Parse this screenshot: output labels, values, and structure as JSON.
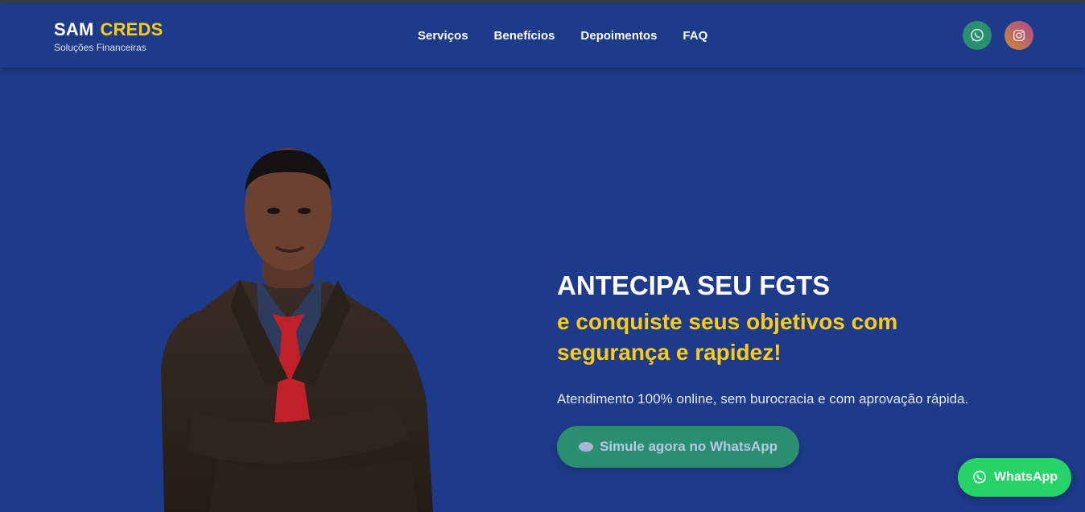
{
  "brand": {
    "name_primary": "SAM",
    "name_accent": "CREDS",
    "tagline": "Soluções Financeiras"
  },
  "nav": {
    "items": [
      {
        "label": "Serviços"
      },
      {
        "label": "Benefícios"
      },
      {
        "label": "Depoimentos"
      },
      {
        "label": "FAQ"
      }
    ]
  },
  "social": {
    "whatsapp_icon": "whatsapp-icon",
    "instagram_icon": "instagram-icon"
  },
  "hero": {
    "title": "ANTECIPA SEU FGTS",
    "subtitle": "e conquiste seus objetivos com segurança e rapidez!",
    "description": "Atendimento 100% online, sem burocracia e com aprovação rápida.",
    "cta_label": "Simule agora no WhatsApp",
    "photo": "man-in-suit-photo"
  },
  "floating_button": {
    "label": "WhatsApp"
  },
  "colors": {
    "background": "#1e3a8a",
    "accent": "#facc15",
    "whatsapp_green": "#25d366",
    "cta_green": "#2a8f6e"
  }
}
